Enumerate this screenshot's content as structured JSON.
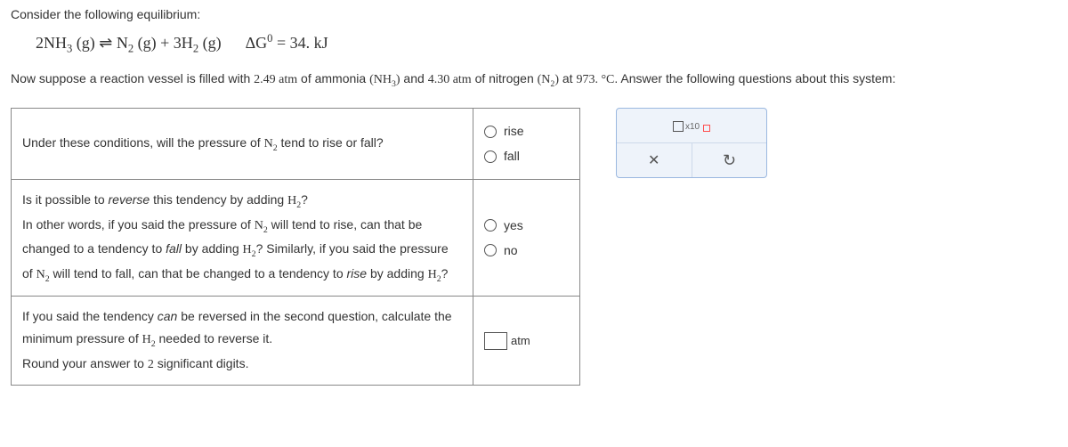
{
  "intro": "Consider the following equilibrium:",
  "equation_html": "2NH<sub>3</sub> (g) ⇌ N<sub>2</sub> (g) + 3H<sub>2</sub> (g) &nbsp;&nbsp;&nbsp; ΔG<sup>0</sup> = 34. kJ",
  "prompt_pre": "Now suppose a reaction vessel is filled with ",
  "val_nh3": "2.49 atm",
  "prompt_mid1": " of ammonia ",
  "nh3_formula": "(NH3)",
  "prompt_mid2": " and ",
  "val_n2": "4.30 atm",
  "prompt_mid3": " of nitrogen ",
  "n2_formula": "(N2)",
  "prompt_mid4": " at ",
  "temp": "973. °C",
  "prompt_end": ". Answer the following questions about this system:",
  "q1": {
    "text_pre": "Under these conditions, will the pressure of ",
    "species": "N2",
    "text_post": " tend to rise or fall?",
    "opt1": "rise",
    "opt2": "fall"
  },
  "q2": {
    "line1_pre": "Is it possible to ",
    "reverse": "reverse",
    "line1_post": " this tendency by adding ",
    "h2": "H2",
    "line1_q": "?",
    "line2_pre": "In other words, if you said the pressure of ",
    "line2_post": " will tend to rise, can that be changed to a tendency to ",
    "fall": "fall",
    "line2_end": " by adding ",
    "line2_q": "? Similarly, if you said the pressure of ",
    "line3_post": " will tend to fall, can that be changed to a tendency to ",
    "rise": "rise",
    "line3_end": " by adding ",
    "line3_q": "?",
    "opt1": "yes",
    "opt2": "no"
  },
  "q3": {
    "line1_pre": "If you said the tendency ",
    "can": "can",
    "line1_post": " be reversed in the second question, calculate the minimum pressure of ",
    "line1_end": " needed to reverse it.",
    "line2_pre": "Round your answer to ",
    "digits": "2",
    "line2_post": " significant digits.",
    "unit": "atm"
  },
  "panel": {
    "x10": "x10",
    "close": "✕",
    "undo": "↺"
  }
}
